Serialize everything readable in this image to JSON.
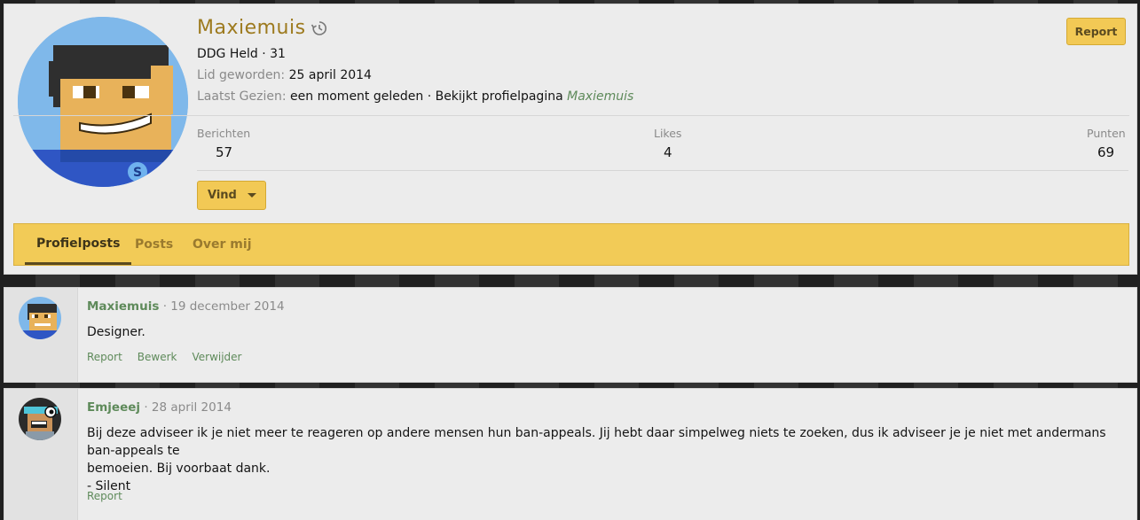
{
  "profile": {
    "name": "Maxiemuis",
    "rank": "DDG Held · 31",
    "joined_label": "Lid geworden:",
    "joined_value": "25 april 2014",
    "last_seen_label": "Laatst Gezien:",
    "last_seen_value": "een moment geleden · Bekijkt profielpagina",
    "last_seen_link": "Maxiemuis",
    "report_label": "Report",
    "find_label": "Vind",
    "stats": [
      {
        "label": "Berichten",
        "value": "57"
      },
      {
        "label": "Likes",
        "value": "4"
      },
      {
        "label": "Punten",
        "value": "69"
      }
    ]
  },
  "tabs": [
    {
      "label": "Profielposts"
    },
    {
      "label": "Posts"
    },
    {
      "label": "Over mij"
    }
  ],
  "posts": [
    {
      "author": "Maxiemuis",
      "date": "· 19 december 2014",
      "lines": [
        "Designer."
      ],
      "actions": [
        "Report",
        "Bewerk",
        "Verwijder"
      ]
    },
    {
      "author": "Emjeeej",
      "date": "· 28 april 2014",
      "lines": [
        "Bij deze adviseer ik je niet meer te reageren op andere mensen hun ban-appeals. Jij hebt daar simpelweg niets te zoeken, dus ik adviseer je je niet met andermans ban-appeals te",
        "bemoeien. Bij voorbaat dank.",
        "- Silent"
      ],
      "actions": [
        "Report"
      ]
    }
  ],
  "colors": {
    "accent_yellow": "#f2cb57",
    "name_gold": "#9d7a1e",
    "link_green": "#5e8a5a"
  }
}
